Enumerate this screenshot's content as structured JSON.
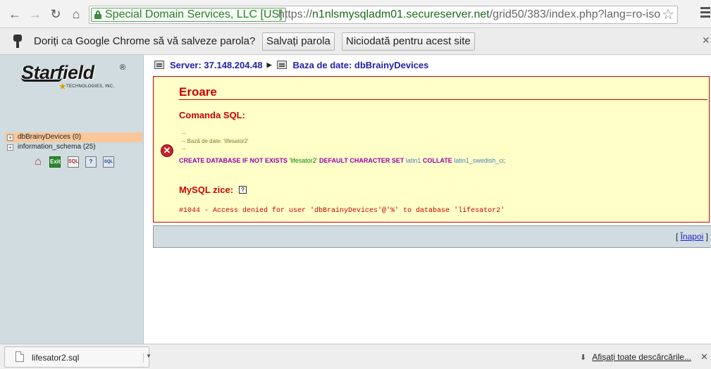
{
  "browser": {
    "ev_label": "Special Domain Services, LLC [US]",
    "url_scheme": "https://",
    "url_host": "n1nlsmysqladm01.secureserver.net",
    "url_path": "/grid50/383/index.php?lang=ro-iso"
  },
  "password_bar": {
    "question": "Doriți ca Google Chrome să vă salveze parola?",
    "save_label": "Salvați parola",
    "never_label": "Niciodată pentru acest site"
  },
  "logo": {
    "name": "Starfield",
    "registered": "®",
    "subtitle": "TECHNOLOGIES, INC."
  },
  "left_icons": [
    {
      "icon": "home-icon",
      "text": ""
    },
    {
      "icon": "exit-icon",
      "text": "Exit"
    },
    {
      "icon": "sql-icon",
      "text": "SQL"
    },
    {
      "icon": "docs-icon",
      "text": "?"
    },
    {
      "icon": "query-icon",
      "text": "SQL"
    }
  ],
  "tree": [
    {
      "label": "dbBrainyDevices (0)",
      "selected": true
    },
    {
      "label": "information_schema (25)",
      "selected": false
    }
  ],
  "breadcrumb": {
    "server": "Server: 37.148.204.48",
    "database": "Baza de date: dbBrainyDevices"
  },
  "error": {
    "title": "Eroare",
    "sql_heading": "Comanda SQL:",
    "comment_lines": "--\n-- Bază de date: 'lifesator2'\n--",
    "sql": {
      "kw1": "CREATE DATABASE IF NOT EXISTS",
      "dbname": "'lifesator2'",
      "kw2": "DEFAULT CHARACTER SET",
      "charset": "latin1",
      "kw3": "COLLATE",
      "collation": "latin1_swedish_ci",
      "end": ";"
    },
    "mysql_says": "MySQL zice:",
    "message": "#1044 - Access denied for user 'dbBrainyDevices'@'%' to database 'lifesator2'"
  },
  "back": {
    "open": "[ ",
    "label": "Înapoi",
    "close": " ]"
  },
  "download_bar": {
    "filename": "lifesator2.sql",
    "show_all": "Afișați toate descărcările..."
  }
}
